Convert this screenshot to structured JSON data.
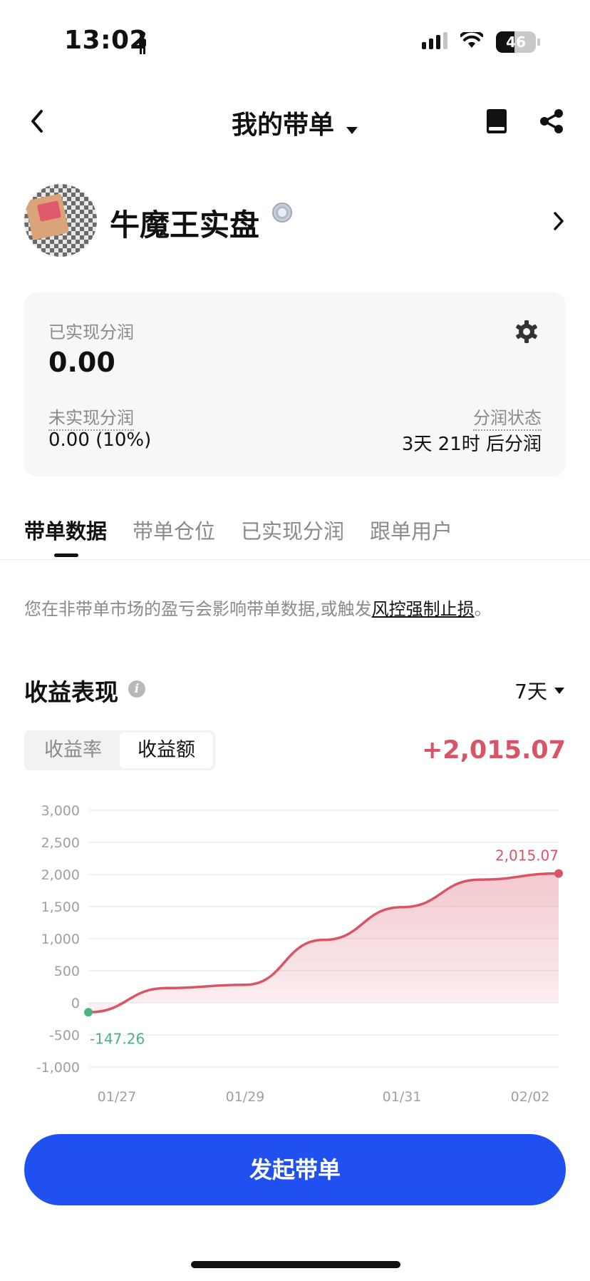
{
  "status_bar": {
    "time": "13:02",
    "battery": "46",
    "battery_level": 0.46
  },
  "nav": {
    "title": "我的带单"
  },
  "profile": {
    "name": "牛魔王实盘"
  },
  "summary": {
    "realized_label": "已实现分润",
    "realized_value": "0.00",
    "unrealized_label": "未实现分润",
    "unrealized_value": "0.00 (10%)",
    "status_label": "分润状态",
    "status_value": "3天 21时 后分润"
  },
  "tabs": [
    {
      "label": "带单数据",
      "active": true
    },
    {
      "label": "带单仓位",
      "active": false
    },
    {
      "label": "已实现分润",
      "active": false
    },
    {
      "label": "跟单用户",
      "active": false
    }
  ],
  "notice": {
    "text": "您在非带单市场的盈亏会影响带单数据,或触发",
    "link": "风控强制止损",
    "suffix": "。"
  },
  "performance": {
    "title": "收益表现",
    "period": "7天",
    "segments": [
      {
        "label": "收益率",
        "active": false
      },
      {
        "label": "收益额",
        "active": true
      }
    ],
    "total": "+2,015.07"
  },
  "chart_data": {
    "type": "area",
    "x": [
      "01/27",
      "01/28",
      "01/29",
      "01/30",
      "01/31",
      "02/01",
      "02/02"
    ],
    "values": [
      -147.26,
      230,
      280,
      980,
      1490,
      1920,
      2015.07
    ],
    "x_tick_labels": [
      "01/27",
      "01/29",
      "01/31",
      "02/02"
    ],
    "y_ticks": [
      3000,
      2500,
      2000,
      1500,
      1000,
      500,
      0,
      -500,
      -1000
    ],
    "y_tick_labels": [
      "3,000",
      "2,500",
      "2,000",
      "1,500",
      "1,000",
      "500",
      "0",
      "-500",
      "-1,000"
    ],
    "ylim": [
      -1000,
      3000
    ],
    "annotations": {
      "start": "-147.26",
      "end": "2,015.07"
    },
    "colors": {
      "line": "#d95566",
      "start_point": "#4cb380",
      "grid": "#eeeeee"
    },
    "grid": true
  },
  "cta": {
    "label": "发起带单"
  }
}
